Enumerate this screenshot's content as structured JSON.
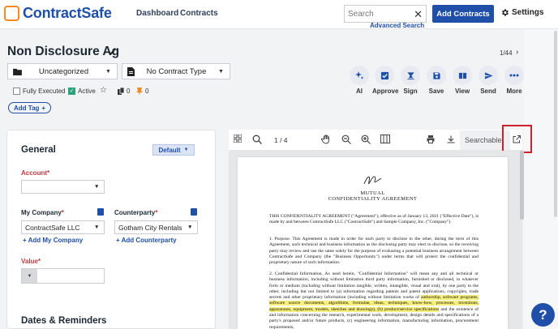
{
  "app": {
    "logo_text": "ContractSafe",
    "brand_color": "#1f4fa8",
    "accent_color": "#f08a24"
  },
  "nav": {
    "dashboard": "Dashboard",
    "contracts": "Contracts"
  },
  "search": {
    "placeholder": "Search",
    "advanced": "Advanced Search"
  },
  "header_buttons": {
    "add_contracts": "Add Contracts",
    "settings": "Settings"
  },
  "contract": {
    "title": "Non Disclosure Ag",
    "pager": "1/44"
  },
  "selects": {
    "folder": "Uncategorized",
    "type": "No Contract Type"
  },
  "actions": [
    "AI",
    "Approve",
    "Sign",
    "Save",
    "View",
    "Send",
    "More"
  ],
  "status": {
    "fully_executed": "Fully Executed",
    "active": "Active",
    "count_a": "0",
    "count_b": "0"
  },
  "add_tag": "Add Tag",
  "general": {
    "title": "General",
    "default_label": "Default",
    "account_label": "Account",
    "account_value": "",
    "my_company_label": "My Company",
    "my_company_value": "ContractSafe LLC",
    "add_my_company": "Add My Company",
    "counterparty_label": "Counterparty",
    "counterparty_value": "Gotham City Rentals",
    "add_counterparty": "Add Counterparty",
    "value_label": "Value",
    "required_mark": "*",
    "dates_title": "Dates & Reminders"
  },
  "viewer": {
    "page": "1 / 4",
    "searchable": "Searchable",
    "doc_title_1": "MUTUAL",
    "doc_title_2": "CONFIDENTIALITY AGREEMENT",
    "p0": "THIS CONFIDENTIALITY AGREEMENT (\"Agreement\"), effective as of January 13, 2021 (\"Effective Date\"), is made by and between ContractSafe LLC (\"ContractSafe\") and Sample Company, Inc. (\"Company\").",
    "p1": "1.   Purpose. This Agreement is made in order for each party to disclose to the other, during the term of this Agreement, such technical and business information as the disclosing party may elect to disclose, so the receiving party may review and use the same solely for the purpose of evaluating a potential business arrangement between ContractSafe and Company (the \"Business Opportunity\") under terms that will protect the confidential and proprietary nature of such information.",
    "p2_pre": "2.   Confidential Information. As used herein, \"Confidential Information\" will mean any and all technical or business information, including without limitation third party information, furnished or disclosed, in whatever form or medium (including without limitation tangible, written, intangible, visual and oral), by one party to the other, including but not limited to (a) information regarding patents and patent applications, copyrights, trade secrets and other proprietary information (including without limitation works of ",
    "p2_hl": "authorship, software programs, software source documents, algorithms, formulae, ideas, techniques, know-how, processes, inventions, apparatuses, equipment, models, sketches and drawings), (b) product/service specifications",
    "p2_post": " and the existence of and information concerning the research, experimental work, development, design details and specifications of a party's proposed and/or future products, (c) engineering information, manufacturing information, procurement requirements,"
  },
  "help": "?"
}
